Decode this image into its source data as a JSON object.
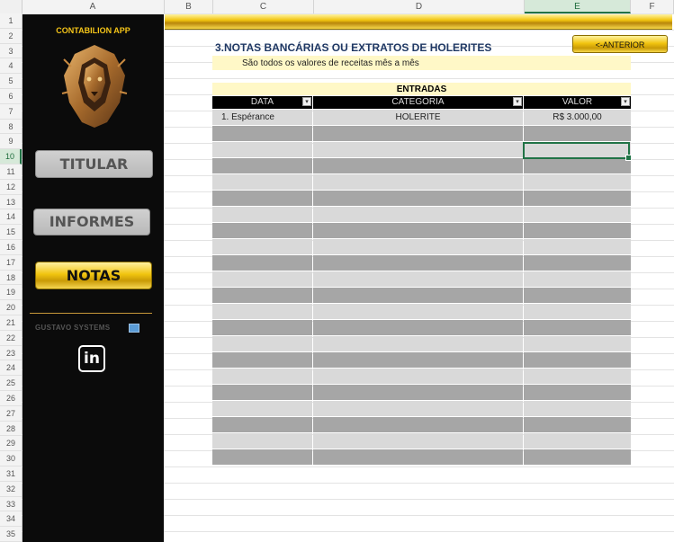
{
  "columns": [
    "A",
    "B",
    "C",
    "D",
    "E",
    "F"
  ],
  "rows": [
    "1",
    "2",
    "3",
    "4",
    "5",
    "6",
    "7",
    "8",
    "9",
    "10",
    "11",
    "12",
    "13",
    "14",
    "15",
    "16",
    "17",
    "18",
    "19",
    "20",
    "21",
    "22",
    "23",
    "24",
    "25",
    "26",
    "27",
    "28",
    "29",
    "30",
    "31",
    "32",
    "33",
    "34",
    "35"
  ],
  "selected_column": "E",
  "selected_row": "10",
  "sidebar": {
    "app_title": "CONTABILION APP",
    "logo_icon": "lion-head-icon",
    "nav": [
      {
        "label": "TITULAR",
        "active": false
      },
      {
        "label": "INFORMES",
        "active": false
      },
      {
        "label": "NOTAS",
        "active": true
      }
    ],
    "brand": "GUSTAVO SYSTEMS",
    "brand_icon": "computer-icon",
    "linkedin_icon": "linkedin-icon",
    "linkedin_label": "in"
  },
  "header": {
    "anterior_label": "<-ANTERIOR",
    "heading": "3.NOTAS BANCÁRIAS OU EXTRATOS DE HOLERITES",
    "subtitle": "São todos os valores de receitas mês a mês"
  },
  "table": {
    "caption": "ENTRADAS",
    "columns": [
      "DATA",
      "CATEGORIA",
      "VALOR"
    ],
    "filter_icon": "dropdown-arrow-icon",
    "rows": [
      [
        "1. Espérance",
        "HOLERITE",
        "R$ 3.000,00"
      ]
    ],
    "total_rows": 22
  },
  "colors": {
    "gold": "#f1c40f",
    "sidebar_bg": "#0b0b0b",
    "heading": "#1f3864",
    "selection": "#217346",
    "band_light": "#d9d9d9",
    "band_dark": "#a6a6a6"
  }
}
